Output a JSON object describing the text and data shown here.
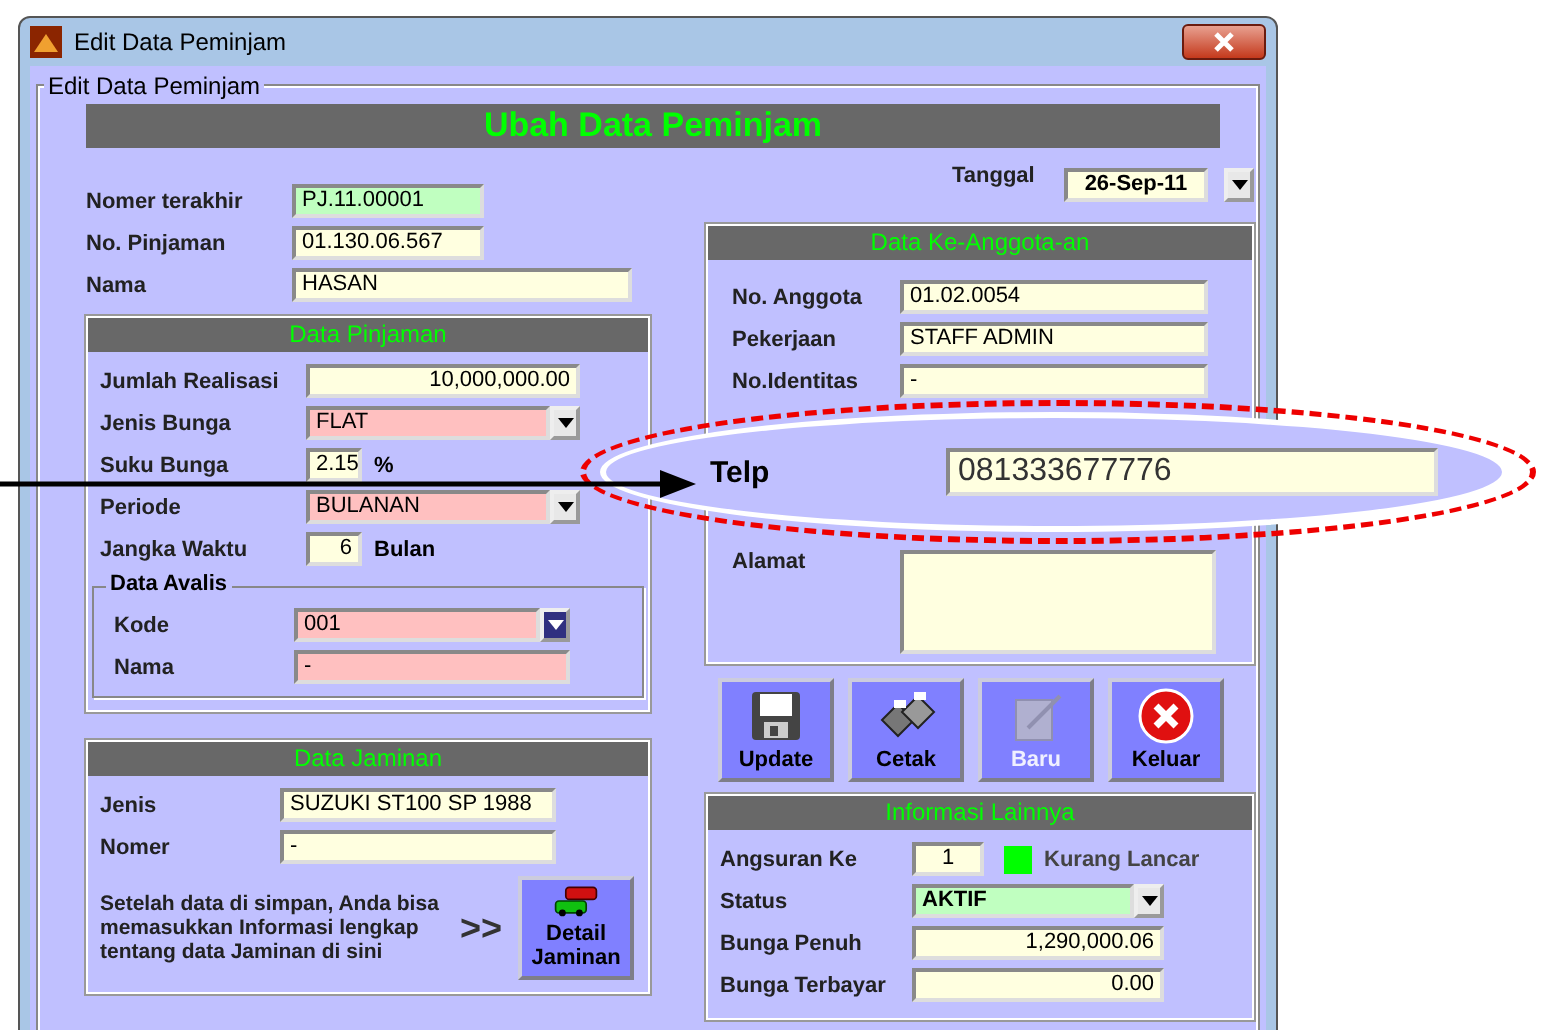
{
  "window": {
    "title": "Edit Data Peminjam",
    "frame_label": "Edit Data Peminjam",
    "heading": "Ubah Data Peminjam"
  },
  "date": {
    "label": "Tanggal",
    "value": "26-Sep-11"
  },
  "borrower": [
    {
      "label": "Nomer terakhir",
      "value": "PJ.11.00001",
      "kind": "code",
      "color": "#c0ffc0"
    },
    {
      "label": "No. Pinjaman",
      "value": "01.130.06.567",
      "kind": "code",
      "color": "#ffffe0"
    },
    {
      "label": "Nama",
      "value": "HASAN",
      "kind": "text",
      "color": "#ffffe0"
    }
  ],
  "loan": {
    "title": "Data Pinjaman",
    "fields": [
      {
        "label": "Jumlah Realisasi",
        "value": "10,000,000.00",
        "kind": "amount",
        "color": "#ffffe0"
      },
      {
        "label": "Jenis Bunga",
        "value": "FLAT",
        "kind": "select",
        "color": "#ffc0c0"
      },
      {
        "label": "Suku Bunga",
        "value": "2.15",
        "kind": "short",
        "color": "#ffffe0",
        "unit": "%"
      },
      {
        "label": "Periode",
        "value": "BULANAN",
        "kind": "select",
        "color": "#ffc0c0"
      },
      {
        "label": "Jangka Waktu",
        "value": "6",
        "kind": "short",
        "color": "#ffffe0",
        "unit": "Bulan"
      }
    ],
    "guarantor": {
      "label": "Data Avalis",
      "fields": [
        {
          "label": "Kode",
          "value": "001",
          "kind": "lookup",
          "color": "#ffc0c0"
        },
        {
          "label": "Nama",
          "value": "-",
          "kind": "text",
          "color": "#ffc0c0"
        }
      ]
    }
  },
  "collateral": {
    "title": "Data Jaminan",
    "fields": [
      {
        "label": "Jenis",
        "value": "SUZUKI ST100 SP 1988",
        "kind": "text",
        "color": "#ffffe0"
      },
      {
        "label": "Nomer",
        "value": "-",
        "kind": "text",
        "color": "#ffffe0"
      }
    ],
    "note": "Setelah data di simpan, Anda bisa memasukkan Informasi lengkap tentang data Jaminan di sini",
    "pointer": ">>",
    "button": "Detail Jaminan"
  },
  "member": {
    "title": "Data Ke-Anggota-an",
    "fields": [
      {
        "label": "No. Anggota",
        "value": "01.02.0054"
      },
      {
        "label": "Pekerjaan",
        "value": "STAFF ADMIN"
      },
      {
        "label": "No.Identitas",
        "value": "-"
      }
    ],
    "address_label": "Alamat"
  },
  "buttons": [
    {
      "label": "Update",
      "kind": "save",
      "disabled": false
    },
    {
      "label": "Cetak",
      "kind": "print",
      "disabled": false
    },
    {
      "label": "Baru",
      "kind": "new",
      "disabled": true
    },
    {
      "label": "Keluar",
      "kind": "exit",
      "disabled": false
    }
  ],
  "other": {
    "title": "Informasi Lainnya",
    "installment": {
      "label": "Angsuran Ke",
      "value": "1",
      "color": "#00ff00",
      "status_text": "Kurang Lancar"
    },
    "fields": [
      {
        "label": "Status",
        "value": "AKTIF",
        "kind": "select",
        "color": "#c0ffc0"
      },
      {
        "label": "Bunga Penuh",
        "value": "1,290,000.06",
        "kind": "amount",
        "color": "#ffffe0"
      },
      {
        "label": "Bunga Terbayar",
        "value": "0.00",
        "kind": "amount",
        "color": "#ffffe0"
      }
    ]
  },
  "callout": {
    "label": "Telp",
    "value": "081333677776"
  }
}
